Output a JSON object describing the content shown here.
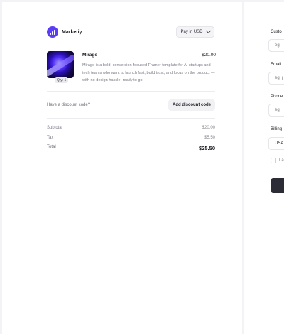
{
  "brand": {
    "name": "Marketiy"
  },
  "currency": {
    "label": "Pay in USD"
  },
  "product": {
    "name": "Mirage",
    "price": "$20.00",
    "qty": "Qty: 1",
    "description": "Mirage is a bold, conversion-focused Framer template for AI startups and tech teams who want to launch fast, build trust, and focus on the product — with no design hassle, ready to go."
  },
  "discount": {
    "question": "Have a discount code?",
    "button": "Add discount code"
  },
  "summary": {
    "subtotal_label": "Subtotal",
    "subtotal": "$20.00",
    "tax_label": "Tax",
    "tax": "$5.50",
    "total_label": "Total",
    "total": "$25.50"
  },
  "form": {
    "customer_label": "Custo",
    "customer_placeholder": "eg. ",
    "email_label": "Email",
    "email_placeholder": "eg. j",
    "phone_label": "Phone",
    "phone_placeholder": "eg. ",
    "billing_label": "Billing",
    "billing_value": "USA",
    "terms_label": "I a"
  },
  "colors": {
    "accent": "#5b3df5",
    "button_dark": "#2b2c36"
  }
}
